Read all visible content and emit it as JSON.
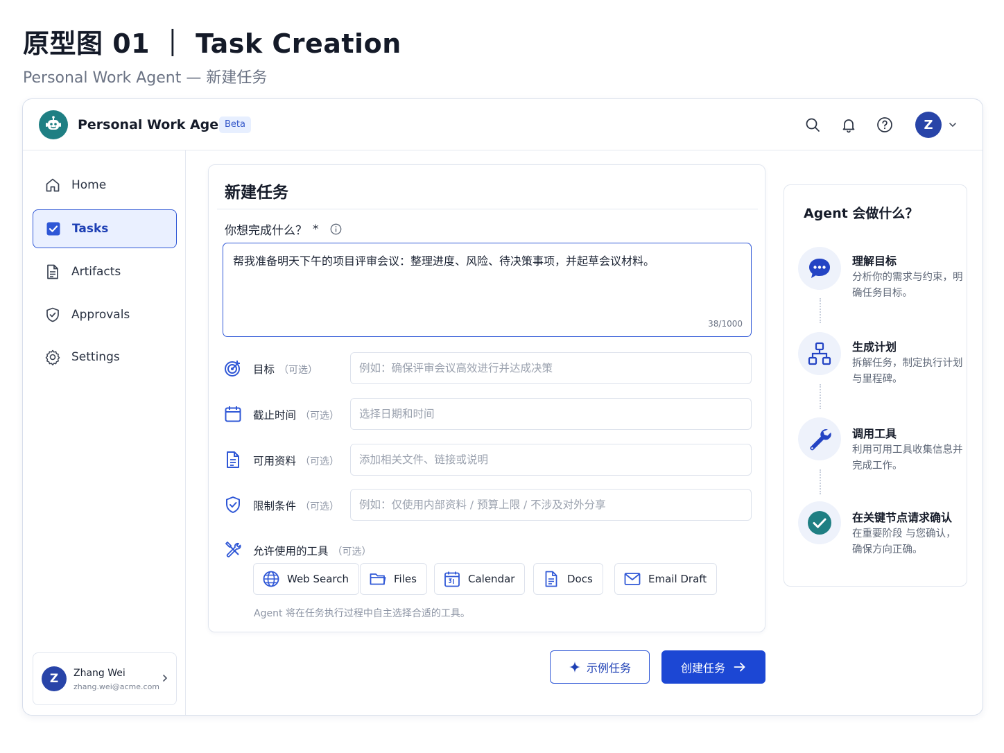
{
  "doc": {
    "title": "原型图 01 ｜ Task Creation",
    "subtitle": "Personal Work Agent — 新建任务"
  },
  "header": {
    "app_name": "Personal Work Agent",
    "badge": "Beta",
    "avatar_initial": "Z",
    "icons": [
      "search-icon",
      "bell-icon",
      "help-icon",
      "chevron-down-icon"
    ]
  },
  "sidebar": {
    "items": [
      {
        "label": "Home",
        "icon": "home-icon",
        "active": false
      },
      {
        "label": "Tasks",
        "icon": "checkbox-icon",
        "active": true
      },
      {
        "label": "Artifacts",
        "icon": "document-icon",
        "active": false
      },
      {
        "label": "Approvals",
        "icon": "shield-check-icon",
        "active": false
      },
      {
        "label": "Settings",
        "icon": "gear-icon",
        "active": false
      }
    ],
    "user": {
      "initial": "Z",
      "name": "Zhang Wei",
      "email": "zhang.wei@acme.com"
    }
  },
  "form": {
    "title": "新建任务",
    "question_label": "你想完成什么？",
    "required_mark": "*",
    "task_text": "帮我准备明天下午的项目评审会议：整理进度、风险、待决策事项，并起草会议材料。",
    "counter": "38/1000",
    "fields": [
      {
        "label": "目标",
        "optional": "（可选）",
        "placeholder": "例如：确保评审会议高效进行并达成决策",
        "icon": "target-icon"
      },
      {
        "label": "截止时间",
        "optional": "（可选）",
        "placeholder": "选择日期和时间",
        "icon": "calendar-icon"
      },
      {
        "label": "可用资料",
        "optional": "（可选）",
        "placeholder": "添加相关文件、链接或说明",
        "icon": "file-icon"
      },
      {
        "label": "限制条件",
        "optional": "（可选）",
        "placeholder": "例如：仅使用内部资料 / 预算上限 / 不涉及对外分享",
        "icon": "shield-icon"
      }
    ],
    "tools_label": "允许使用的工具",
    "tools_optional": "（可选）",
    "tools": [
      {
        "label": "Web Search",
        "icon": "globe-icon"
      },
      {
        "label": "Files",
        "icon": "folder-icon"
      },
      {
        "label": "Calendar",
        "icon": "calendar-icon"
      },
      {
        "label": "Docs",
        "icon": "doc-icon"
      },
      {
        "label": "Email Draft",
        "icon": "mail-icon"
      }
    ],
    "tools_hint": "Agent 将在任务执行过程中自主选择合适的工具。"
  },
  "actions": {
    "example_label": "示例任务",
    "create_label": "创建任务"
  },
  "agent_panel": {
    "title": "Agent 会做什么？",
    "steps": [
      {
        "title": "理解目标",
        "desc": "分析你的需求与约束，明确任务目标。",
        "icon": "chat-icon"
      },
      {
        "title": "生成计划",
        "desc": "拆解任务，制定执行计划与里程碑。",
        "icon": "hierarchy-icon"
      },
      {
        "title": "调用工具",
        "desc": "利用可用工具收集信息并完成工作。",
        "icon": "wrench-icon"
      },
      {
        "title": "在关键节点请求确认",
        "desc": "在重要阶段 与您确认，确保方向正确。",
        "icon": "check-circle-icon"
      }
    ]
  },
  "colors": {
    "primary": "#1c47d4",
    "logo": "#1f7f83",
    "step_check": "#1f7f83"
  }
}
